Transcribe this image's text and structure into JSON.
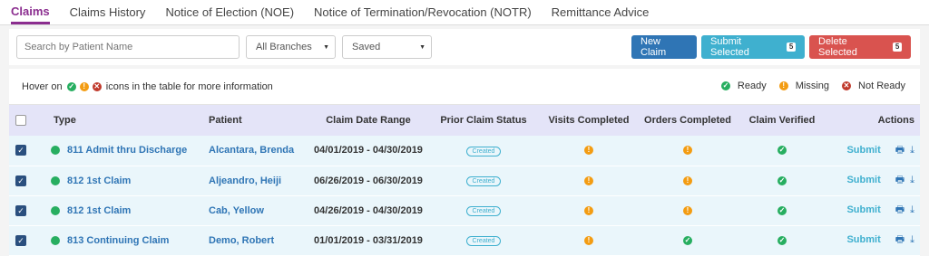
{
  "tabs": [
    "Claims",
    "Claims History",
    "Notice of Election (NOE)",
    "Notice of Termination/Revocation (NOTR)",
    "Remittance Advice"
  ],
  "toolbar": {
    "search_placeholder": "Search by Patient Name",
    "branch_select": "All Branches",
    "status_select": "Saved",
    "new_claim": "New Claim",
    "submit_selected": "Submit Selected",
    "submit_count": "5",
    "delete_selected": "Delete Selected",
    "delete_count": "5"
  },
  "hint": {
    "prefix": "Hover on",
    "suffix": "icons in the table for more information"
  },
  "legend": {
    "ready": "Ready",
    "missing": "Missing",
    "not_ready": "Not Ready"
  },
  "columns": [
    "Type",
    "Patient",
    "Claim Date Range",
    "Prior Claim Status",
    "Visits Completed",
    "Orders Completed",
    "Claim Verified",
    "Actions"
  ],
  "rows": [
    {
      "type": "811 Admit thru Discharge",
      "patient": "Alcantara, Brenda",
      "range": "04/01/2019 - 04/30/2019",
      "prior": "Created",
      "visits": "missing",
      "orders": "missing",
      "verified": "ready",
      "action": "Submit"
    },
    {
      "type": "812 1st Claim",
      "patient": "Aljeandro, Heiji",
      "range": "06/26/2019 - 06/30/2019",
      "prior": "Created",
      "visits": "missing",
      "orders": "missing",
      "verified": "ready",
      "action": "Submit"
    },
    {
      "type": "812 1st Claim",
      "patient": "Cab, Yellow",
      "range": "04/26/2019 - 04/30/2019",
      "prior": "Created",
      "visits": "missing",
      "orders": "missing",
      "verified": "ready",
      "action": "Submit"
    },
    {
      "type": "813 Continuing Claim",
      "patient": "Demo, Robert",
      "range": "01/01/2019 - 03/31/2019",
      "prior": "Created",
      "visits": "missing",
      "orders": "ready",
      "verified": "ready",
      "action": "Submit"
    }
  ],
  "colors": {
    "accent": "#8b2d8f",
    "primary": "#2f75b5",
    "info": "#3fb0cf",
    "danger": "#d9534f",
    "ready": "#27ae60",
    "missing": "#f39c12",
    "not_ready": "#c0392b"
  }
}
